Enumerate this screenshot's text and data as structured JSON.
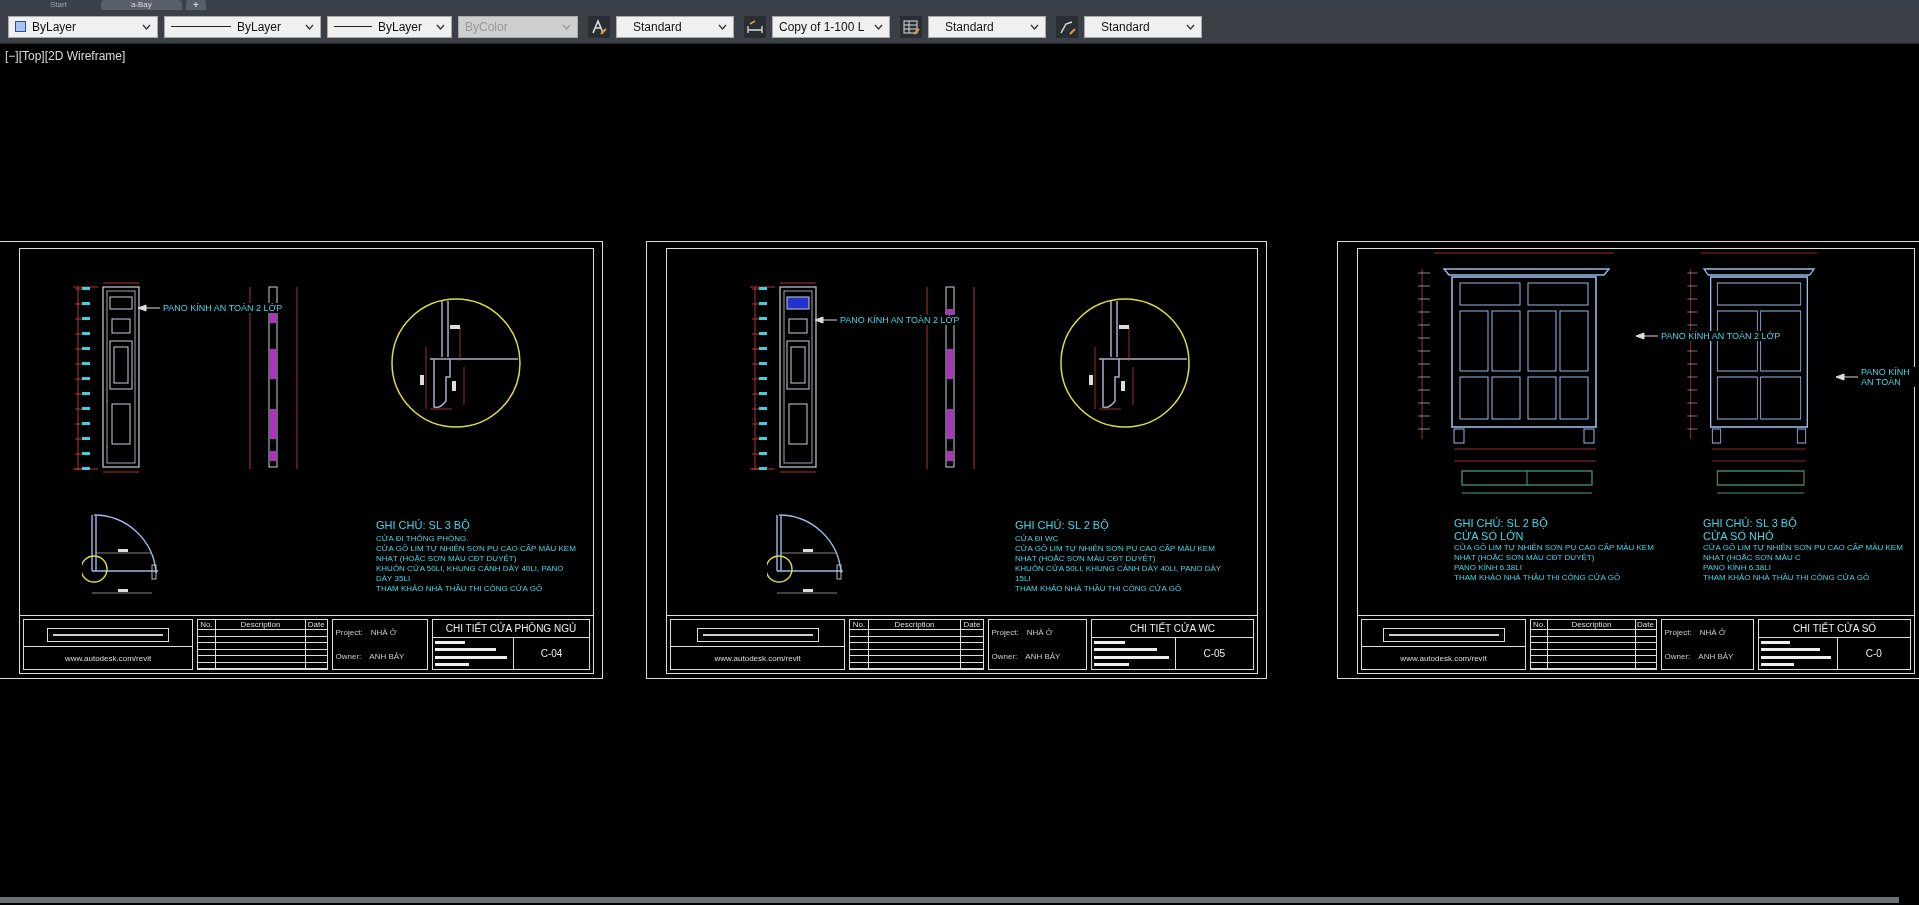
{
  "tabs": [
    {
      "label": "Start",
      "selected": false
    },
    {
      "label": "a-Bay",
      "selected": true
    }
  ],
  "new_tab_button": "+",
  "toolbar": [
    {
      "kind": "color",
      "value": "ByLayer",
      "disabled": false
    },
    {
      "kind": "linetype",
      "value": "ByLayer",
      "disabled": false
    },
    {
      "kind": "lineweight",
      "value": "ByLayer",
      "disabled": false
    },
    {
      "kind": "plotstyle",
      "value": "ByColor",
      "disabled": true
    },
    {
      "kind": "text-style",
      "value": "Standard",
      "disabled": false
    },
    {
      "kind": "dim-style",
      "value": "Copy of 1-100 L",
      "disabled": false
    },
    {
      "kind": "table-style",
      "value": "Standard",
      "disabled": false
    },
    {
      "kind": "mleader-style",
      "value": "Standard",
      "disabled": false
    }
  ],
  "viewport_label": "[−][Top][2D Wireframe]",
  "sheets": [
    {
      "kind": "door",
      "views": [
        {
          "callout": "PANO KÍNH AN TOÀN 2 LỚP",
          "headings": [
            "GHI CHÚ: SL 3 BỘ"
          ],
          "lines": [
            "CỬA ĐI THÔNG PHÒNG.",
            "CỬA GỖ LIM TỰ NHIÊN SƠN PU CAO CẤP MÀU KEM NHẠT (HOẶC SƠN MÀU CĐT DUYỆT)",
            "KHUÔN CỬA 50LI, KHUNG CÁNH DÀY 40LI, PANO DÀY 35LI",
            "THAM KHẢO NHÀ THẦU THI CÔNG CỬA GỖ"
          ]
        }
      ],
      "title_block": {
        "columns": [
          "No.",
          "Description",
          "Date"
        ],
        "project_label": "Project:",
        "project": "NHÀ Ở",
        "owner_label": "Owner:",
        "owner": "ANH BẢY",
        "title": "CHI TIẾT CỬA PHÒNG NGỦ",
        "sheet_number": "C-04",
        "website": "www.autodesk.com/revit"
      }
    },
    {
      "kind": "door",
      "views": [
        {
          "callout": "PANO KÍNH AN TOÀN 2 LỚP",
          "headings": [
            "GHI CHÚ: SL 2 BỘ"
          ],
          "lines": [
            "CỬA ĐI WC",
            "CỬA GỖ LIM TỰ NHIÊN SƠN PU CAO CẤP MÀU KEM NHẠT (HOẶC SƠN MÀU CĐT DUYỆT)",
            "KHUÔN CỬA 50LI, KHUNG CÁNH DÀY 40LI, PANO DÀY 15LI",
            "THAM KHẢO NHÀ THẦU THI CÔNG CỬA GỖ"
          ]
        }
      ],
      "title_block": {
        "columns": [
          "No.",
          "Description",
          "Date"
        ],
        "project_label": "Project:",
        "project": "NHÀ Ở",
        "owner_label": "Owner:",
        "owner": "ANH BẢY",
        "title": "CHI TIẾT CỬA WC",
        "sheet_number": "C-05",
        "website": "www.autodesk.com/revit"
      }
    },
    {
      "kind": "window",
      "views": [
        {
          "callout": "PANO KÍNH AN TOÀN 2 LỚP",
          "headings": [
            "GHI CHÚ: SL 2 BỘ",
            "CỬA SỔ LỚN"
          ],
          "lines": [
            "CỬA GỖ LIM TỰ NHIÊN SƠN PU CAO CẤP MÀU KEM NHẠT (HOẶC SƠN MÀU CĐT DUYỆT)",
            "PANO KÍNH 6.38LI",
            "THAM KHẢO NHÀ THẦU THI CÔNG CỬA GỖ"
          ]
        },
        {
          "callout": "PANO KÍNH AN TOÀN",
          "headings": [
            "GHI CHÚ: SL 3 BỘ",
            "CỬA SỔ NHỎ"
          ],
          "lines": [
            "CỬA GỖ LIM TỰ NHIÊN SƠN PU CAO CẤP MÀU KEM NHẠT (HOẶC SƠN MÀU C",
            "PANO KÍNH 6.38LI",
            "THAM KHẢO NHÀ THẦU THI CÔNG CỬA GỖ"
          ]
        }
      ],
      "title_block": {
        "columns": [
          "No.",
          "Description",
          "Date"
        ],
        "project_label": "Project:",
        "project": "NHÀ Ở",
        "owner_label": "Owner:",
        "owner": "ANH BẢY",
        "title": "CHI TIẾT CỬA SỔ",
        "sheet_number": "C-0",
        "website": "www.autodesk.com/revit"
      }
    }
  ]
}
